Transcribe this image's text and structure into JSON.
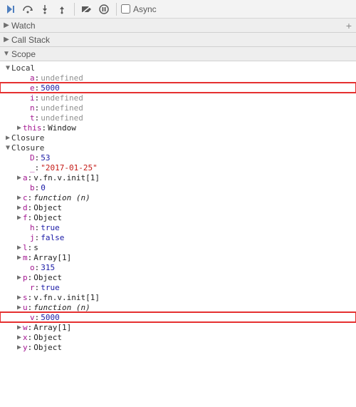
{
  "toolbar": {
    "async_label": "Async",
    "async_checked": false
  },
  "panels": {
    "watch": {
      "title": "Watch",
      "expanded": false
    },
    "callstack": {
      "title": "Call Stack",
      "expanded": false
    },
    "scope": {
      "title": "Scope",
      "expanded": true
    }
  },
  "scope": {
    "local": {
      "label": "Local",
      "vars": [
        {
          "k": "a",
          "v": "undefined",
          "t": "undef"
        },
        {
          "k": "e",
          "v": "5000",
          "t": "num",
          "hl": true
        },
        {
          "k": "i",
          "v": "undefined",
          "t": "undef"
        },
        {
          "k": "n",
          "v": "undefined",
          "t": "undef"
        },
        {
          "k": "t",
          "v": "undefined",
          "t": "undef"
        },
        {
          "k": "this",
          "v": "Window",
          "t": "obj",
          "exp": true
        }
      ]
    },
    "closure1": {
      "label": "Closure"
    },
    "closure2": {
      "label": "Closure",
      "vars": [
        {
          "k": "D",
          "v": "53",
          "t": "num"
        },
        {
          "k": "_",
          "v": "\"2017-01-25\"",
          "t": "str"
        },
        {
          "k": "a",
          "v": "v.fn.v.init[1]",
          "t": "obj",
          "exp": true
        },
        {
          "k": "b",
          "v": "0",
          "t": "num"
        },
        {
          "k": "c",
          "v": "function (n)",
          "t": "ital",
          "exp": true
        },
        {
          "k": "d",
          "v": "Object",
          "t": "obj",
          "exp": true
        },
        {
          "k": "f",
          "v": "Object",
          "t": "obj",
          "exp": true
        },
        {
          "k": "h",
          "v": "true",
          "t": "num"
        },
        {
          "k": "j",
          "v": "false",
          "t": "num"
        },
        {
          "k": "l",
          "v": "s",
          "t": "obj",
          "exp": true
        },
        {
          "k": "m",
          "v": "Array[1]",
          "t": "obj",
          "exp": true
        },
        {
          "k": "o",
          "v": "315",
          "t": "num"
        },
        {
          "k": "p",
          "v": "Object",
          "t": "obj",
          "exp": true
        },
        {
          "k": "r",
          "v": "true",
          "t": "num"
        },
        {
          "k": "s",
          "v": "v.fn.v.init[1]",
          "t": "obj",
          "exp": true
        },
        {
          "k": "u",
          "v": "function (n)",
          "t": "ital",
          "exp": true
        },
        {
          "k": "v",
          "v": "5000",
          "t": "num",
          "hl": true
        },
        {
          "k": "w",
          "v": "Array[1]",
          "t": "obj",
          "exp": true
        },
        {
          "k": "x",
          "v": "Object",
          "t": "obj",
          "exp": true
        },
        {
          "k": "y",
          "v": "Object",
          "t": "obj",
          "exp": true
        }
      ]
    }
  }
}
